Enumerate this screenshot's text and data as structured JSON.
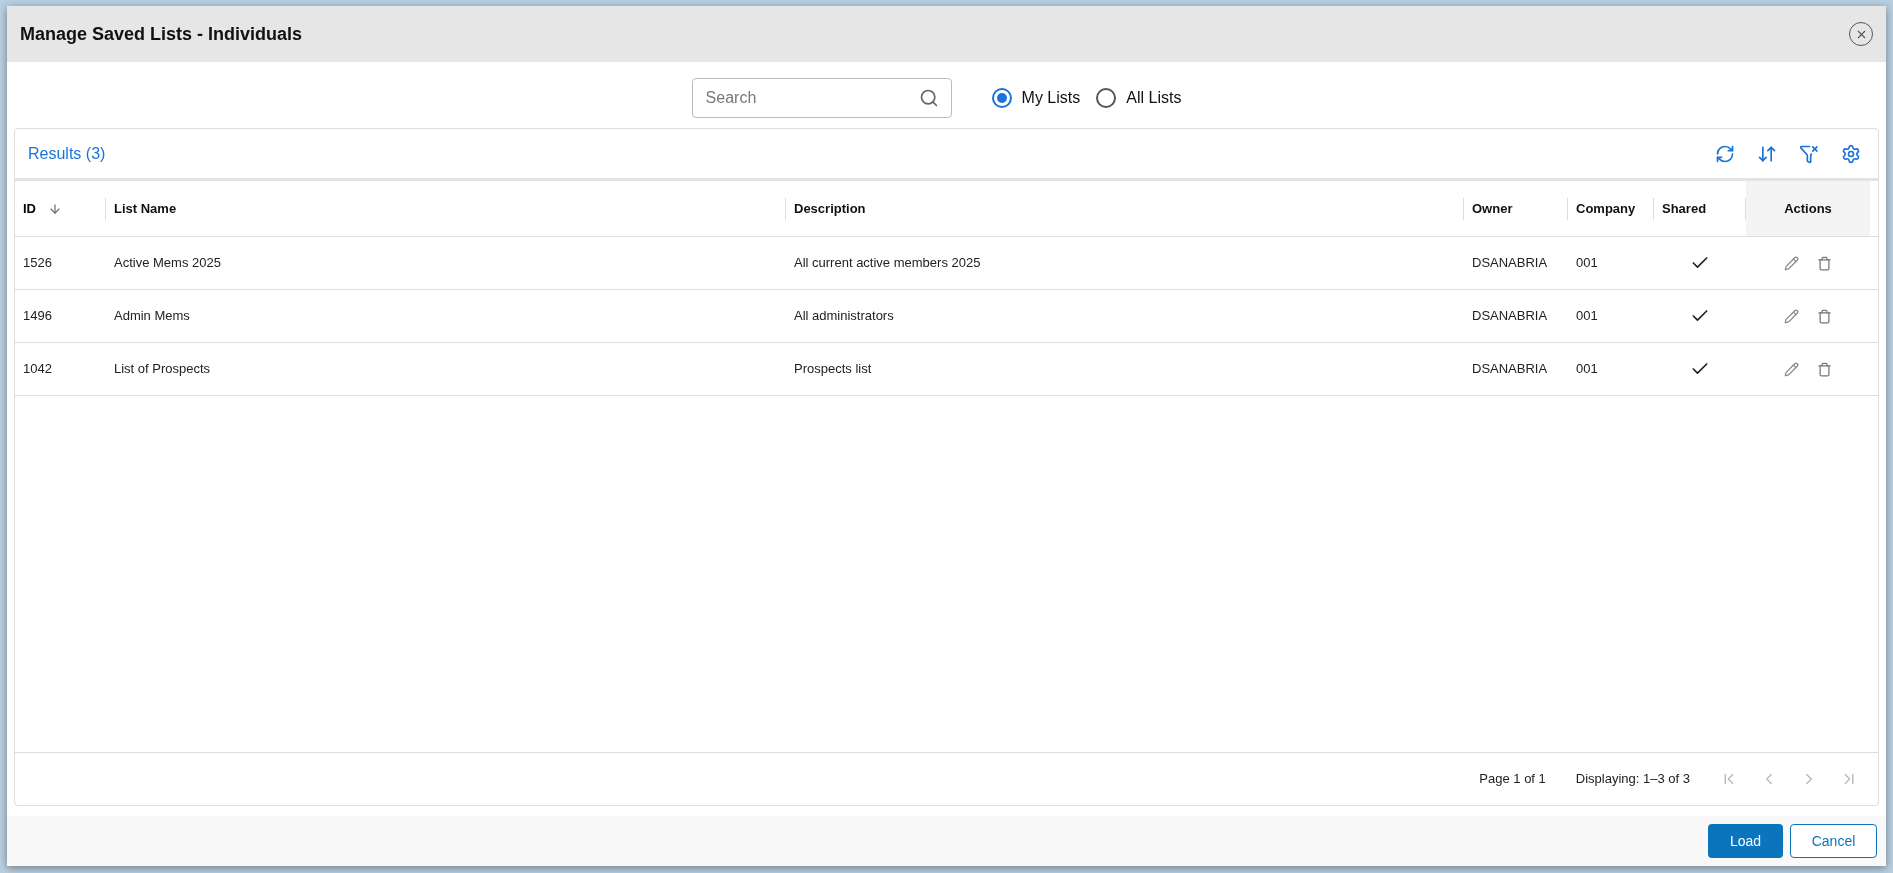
{
  "dialog": {
    "title": "Manage Saved Lists - Individuals"
  },
  "search": {
    "placeholder": "Search"
  },
  "scope": [
    {
      "label": "My Lists",
      "selected": true
    },
    {
      "label": "All Lists",
      "selected": false
    }
  ],
  "results": {
    "title": "Results (3)"
  },
  "table": {
    "columns": [
      {
        "label": "ID",
        "sorted": true
      },
      {
        "label": "List Name",
        "sorted": false
      },
      {
        "label": "Description",
        "sorted": false
      },
      {
        "label": "Owner",
        "sorted": false
      },
      {
        "label": "Company",
        "sorted": false
      },
      {
        "label": "Shared",
        "sorted": false
      },
      {
        "label": "Actions",
        "sorted": false
      }
    ],
    "rows": [
      {
        "id": "1526",
        "name": "Active Mems 2025",
        "description": "All current active members 2025",
        "owner": "DSANABRIA",
        "company": "001",
        "shared": true
      },
      {
        "id": "1496",
        "name": "Admin Mems",
        "description": "All administrators",
        "owner": "DSANABRIA",
        "company": "001",
        "shared": true
      },
      {
        "id": "1042",
        "name": "List of Prospects",
        "description": "Prospects list",
        "owner": "DSANABRIA",
        "company": "001",
        "shared": true
      }
    ]
  },
  "pagination": {
    "page": "Page 1 of 1",
    "displaying": "Displaying: 1–3 of 3"
  },
  "buttons": [
    {
      "label": "Load",
      "kind": "primary"
    },
    {
      "label": "Cancel",
      "kind": "secondary"
    }
  ]
}
